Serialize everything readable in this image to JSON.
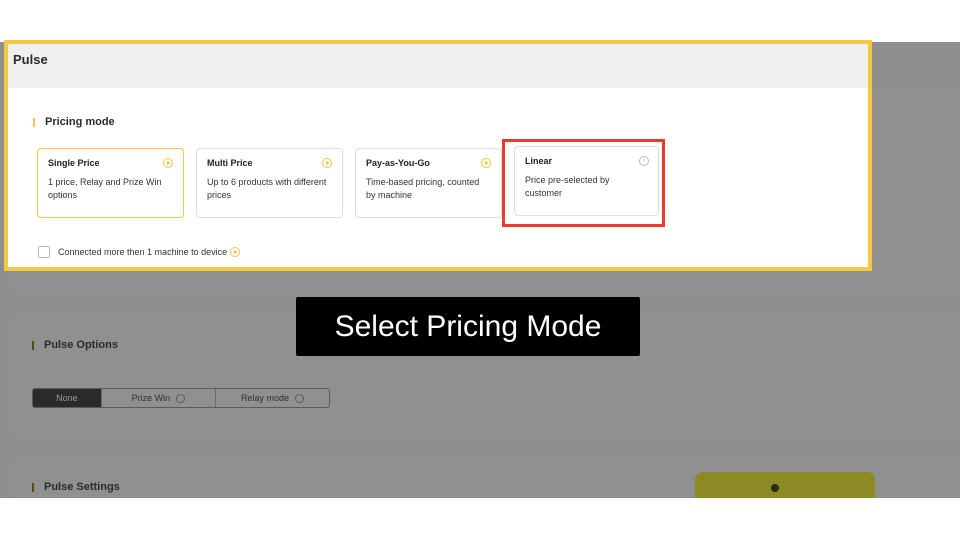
{
  "panel": {
    "title": "Pulse"
  },
  "pricing": {
    "section_title": "Pricing mode",
    "cards": [
      {
        "title": "Single Price",
        "desc": "1 price, Relay and Prize Win options",
        "icon": "play-circle-icon"
      },
      {
        "title": "Multi Price",
        "desc": "Up to 6 products with different prices",
        "icon": "play-circle-icon"
      },
      {
        "title": "Pay-as-You-Go",
        "desc": "Time-based pricing, counted by machine",
        "icon": "play-circle-icon"
      },
      {
        "title": "Linear",
        "desc": "Price pre-selected by customer",
        "icon": "info-icon"
      }
    ],
    "selected_index": 0,
    "checkbox_label": "Connected more then 1 machine to device"
  },
  "options": {
    "section_title": "Pulse Options",
    "segments": [
      "None",
      "Prize Win",
      "Relay mode"
    ],
    "active": "None"
  },
  "settings": {
    "section_title": "Pulse Settings"
  },
  "caption": "Select Pricing Mode",
  "colors": {
    "highlight": "#f6c744",
    "callout": "#ea3b2f",
    "caption_bg": "#000000"
  }
}
